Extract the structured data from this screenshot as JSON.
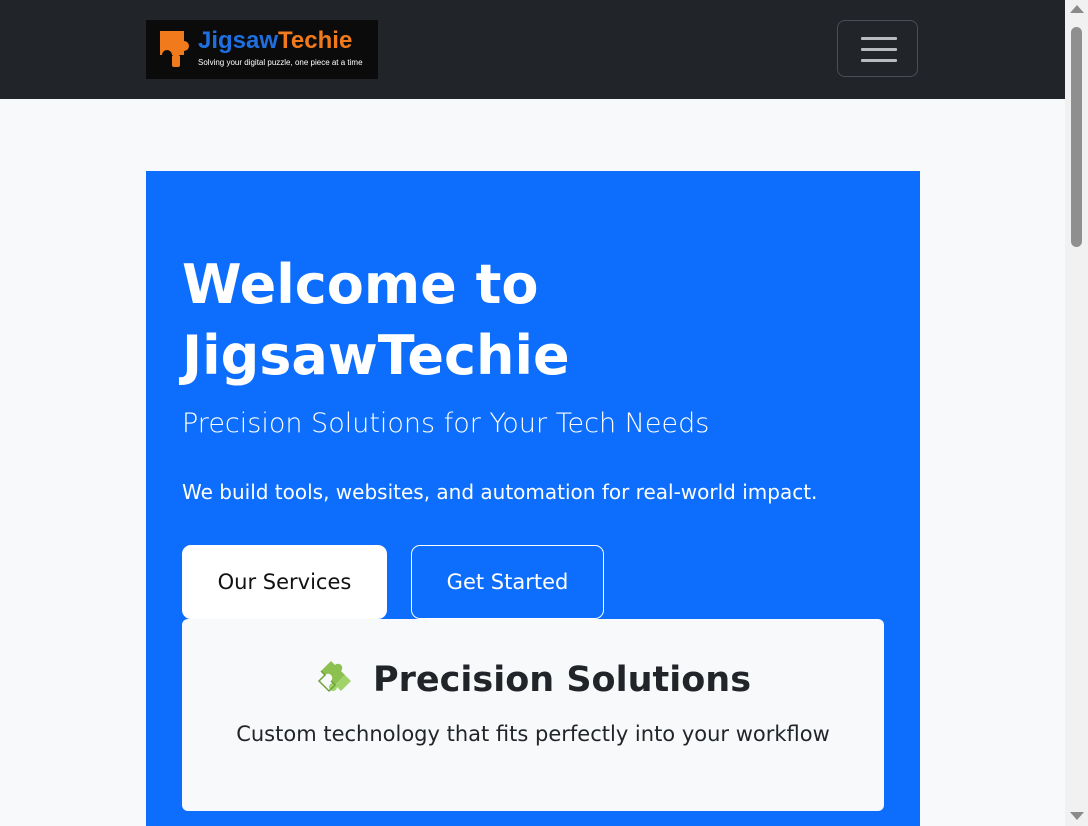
{
  "brand": {
    "name_part1": "Jigsaw",
    "name_part2": "Techie",
    "tagline": "Solving your digital puzzle, one piece at a time"
  },
  "navbar": {
    "toggler_icon": "hamburger-icon"
  },
  "hero": {
    "title": "Welcome to JigsawTechie",
    "subtitle": "Precision Solutions for Your Tech Needs",
    "body": "We build tools, websites, and automation for real-world impact.",
    "buttons": {
      "services": "Our Services",
      "started": "Get Started"
    }
  },
  "card": {
    "icon": "puzzle-piece-icon",
    "title": "Precision Solutions",
    "text": "Custom technology that fits perfectly into your workflow"
  },
  "colors": {
    "navbar": "#212529",
    "primary": "#0d6efd",
    "page_bg": "#f8f9fa",
    "logo_blue": "#1f6fe0",
    "logo_orange": "#f07a1c"
  }
}
